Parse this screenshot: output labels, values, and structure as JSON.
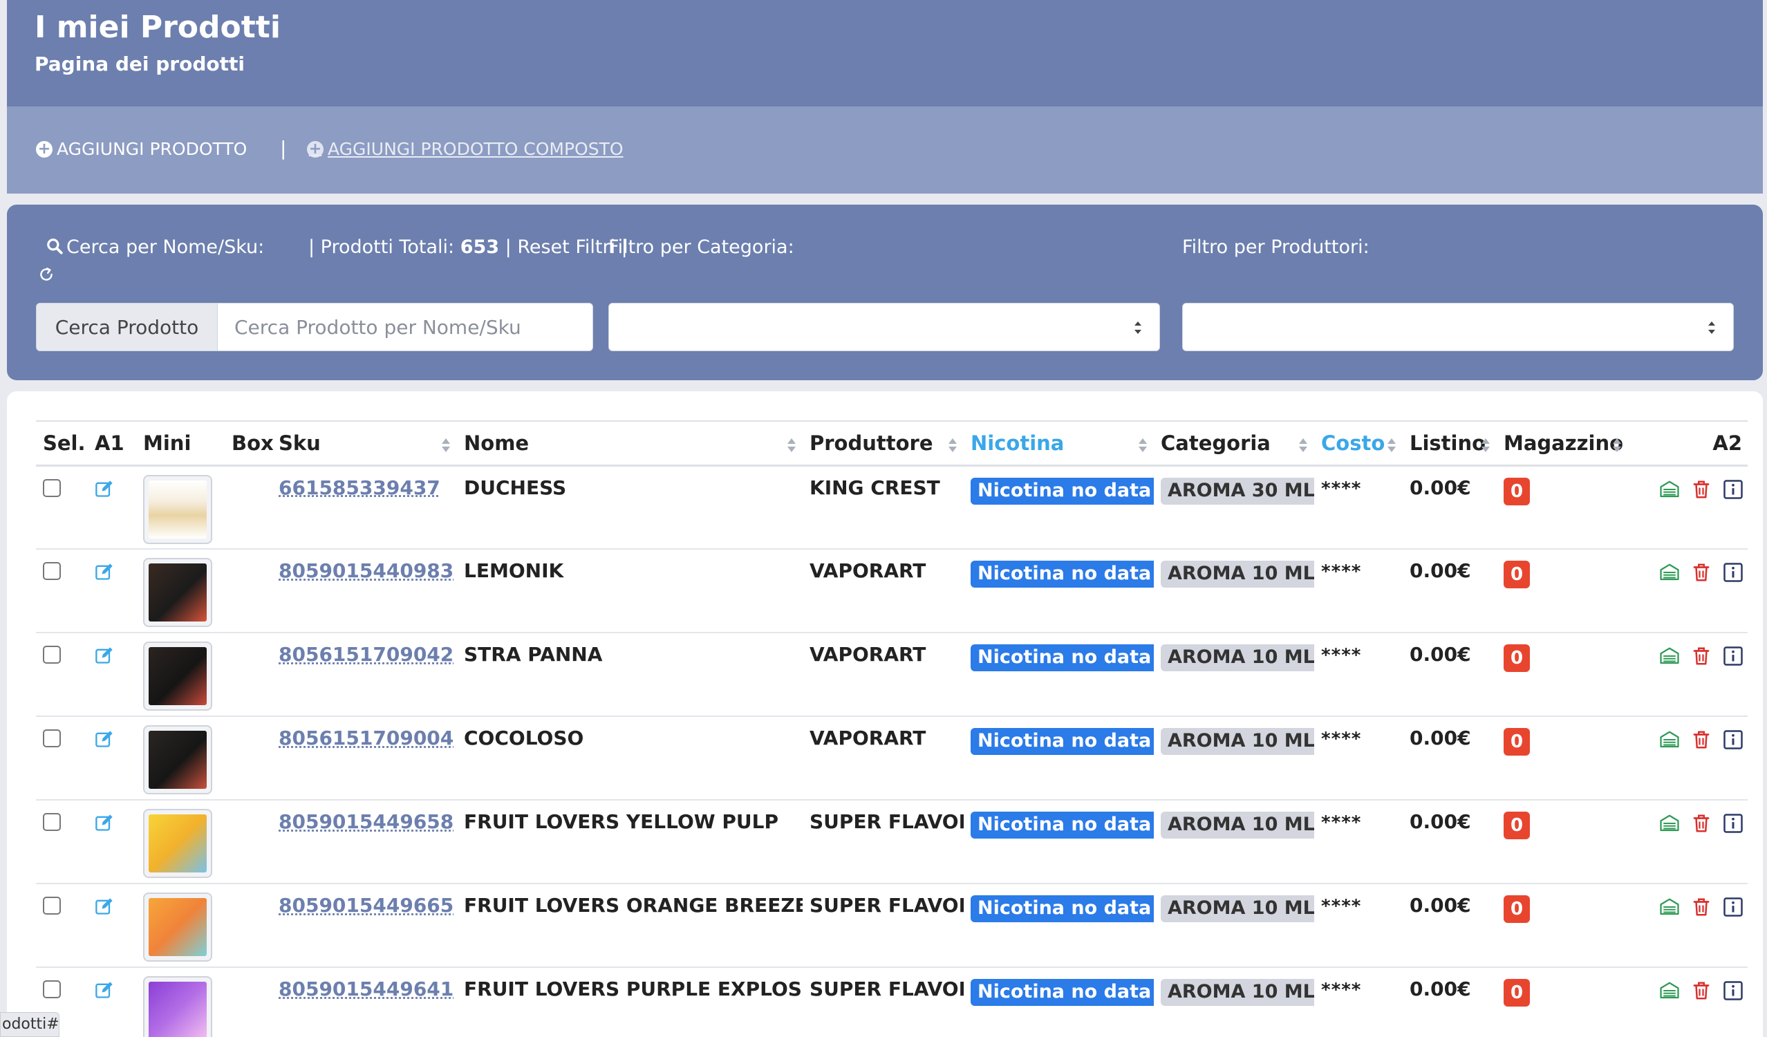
{
  "header": {
    "title": "I miei Prodotti",
    "subtitle": "Pagina dei prodotti"
  },
  "actions": {
    "add_product": "AGGIUNGI PRODOTTO",
    "separator": "|",
    "add_compound": " AGGIUNGI PRODOTTO COMPOSTO"
  },
  "filters": {
    "search_label": "Cerca per Nome/Sku:",
    "totals_prefix": "| Prodotti Totali:",
    "totals_count": "653",
    "reset": "| Reset Filtri |",
    "category_label": "Filtro per Categoria:",
    "producer_label": "Filtro per Produttori:",
    "search_addon": "Cerca Prodotto",
    "search_placeholder": "Cerca Prodotto per Nome/Sku",
    "search_value": "",
    "category_value": "",
    "producer_value": ""
  },
  "table": {
    "columns": {
      "sel": "Sel.",
      "a1": "A1",
      "mini": "Mini",
      "box": "Box",
      "sku": "Sku",
      "nome": "Nome",
      "produttore": "Produttore",
      "nicotina": "Nicotina",
      "categoria": "Categoria",
      "costo": "Costo",
      "listino": "Listino",
      "magazzino": "Magazzino",
      "a2": "A2"
    },
    "rows": [
      {
        "sku": "661585339437",
        "nome": "DUCHESS",
        "produttore": "KING CREST",
        "nicotina": "Nicotina no data",
        "categoria": "AROMA 30 ML",
        "costo": "****",
        "listino": "0.00€",
        "magazzino": "0"
      },
      {
        "sku": "8059015440983",
        "nome": "LEMONIK",
        "produttore": "VAPORART",
        "nicotina": "Nicotina no data",
        "categoria": "AROMA 10 ML",
        "costo": "****",
        "listino": "0.00€",
        "magazzino": "0"
      },
      {
        "sku": "8056151709042",
        "nome": "STRA PANNA",
        "produttore": "VAPORART",
        "nicotina": "Nicotina no data",
        "categoria": "AROMA 10 ML",
        "costo": "****",
        "listino": "0.00€",
        "magazzino": "0"
      },
      {
        "sku": "8056151709004",
        "nome": "COCOLOSO",
        "produttore": "VAPORART",
        "nicotina": "Nicotina no data",
        "categoria": "AROMA 10 ML",
        "costo": "****",
        "listino": "0.00€",
        "magazzino": "0"
      },
      {
        "sku": "8059015449658",
        "nome": "FRUIT LOVERS YELLOW PULP",
        "produttore": "SUPER FLAVOR",
        "nicotina": "Nicotina no data",
        "categoria": "AROMA 10 ML",
        "costo": "****",
        "listino": "0.00€",
        "magazzino": "0"
      },
      {
        "sku": "8059015449665",
        "nome": "FRUIT LOVERS ORANGE BREEZE",
        "produttore": "SUPER FLAVOR",
        "nicotina": "Nicotina no data",
        "categoria": "AROMA 10 ML",
        "costo": "****",
        "listino": "0.00€",
        "magazzino": "0"
      },
      {
        "sku": "8059015449641",
        "nome": "FRUIT LOVERS PURPLE EXPLOSION",
        "produttore": "SUPER FLAVOR",
        "nicotina": "Nicotina no data",
        "categoria": "AROMA 10 ML",
        "costo": "****",
        "listino": "0.00€",
        "magazzino": "0"
      }
    ]
  },
  "status_tip": "odotti#",
  "colors": {
    "header": "#6c7fae",
    "actions": "#8d9cc2",
    "nicotina_badge": "#2b7be8",
    "stock_badge": "#e8452f",
    "accent_blue": "#3aa7e8"
  }
}
